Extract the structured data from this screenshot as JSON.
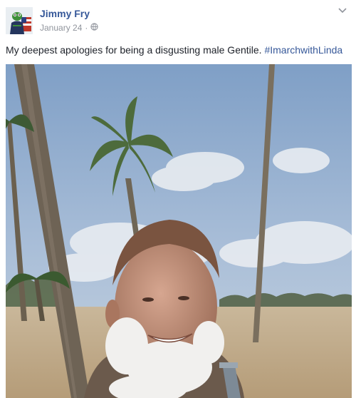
{
  "post": {
    "author": "Jimmy Fry",
    "date": "January 24",
    "separator": "·",
    "audience_icon": "globe-icon",
    "options_icon": "chevron-down-icon",
    "text": "My deepest apologies for being a disgusting male Gentile.",
    "hashtag": "#ImarchwithLinda"
  },
  "colors": {
    "link": "#365899",
    "meta": "#90949c",
    "body_text": "#1d2129"
  }
}
